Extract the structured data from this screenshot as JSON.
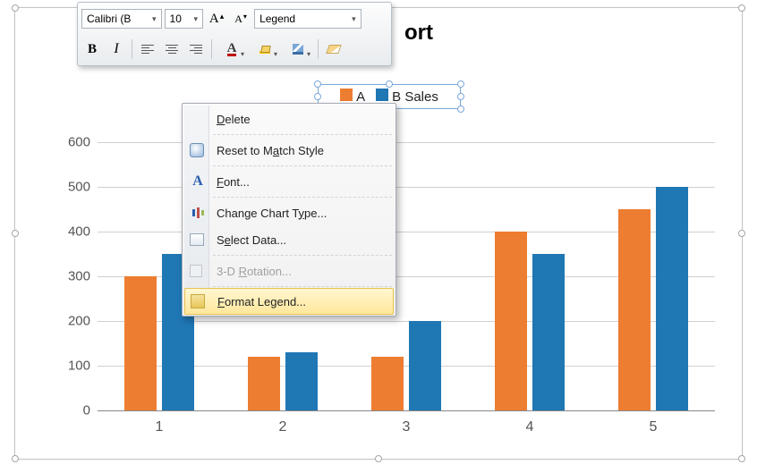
{
  "chart_data": {
    "type": "bar",
    "title": "ort",
    "categories": [
      "1",
      "2",
      "3",
      "4",
      "5"
    ],
    "series": [
      {
        "name": "A",
        "color": "#ED7D31",
        "values": [
          300,
          120,
          120,
          400,
          450
        ]
      },
      {
        "name": "B Sales",
        "color": "#1F77B4",
        "values": [
          350,
          130,
          200,
          350,
          500
        ]
      }
    ],
    "ylim": [
      0,
      600
    ],
    "y_ticks": [
      0,
      100,
      200,
      300,
      400,
      500,
      600
    ],
    "xlabel": "",
    "ylabel": "",
    "legend_position": "top"
  },
  "mini_toolbar": {
    "font_name": "Calibri (B",
    "font_size": "10",
    "style_box": "Legend",
    "bold": "B",
    "italic": "I",
    "grow_font": "A",
    "grow_font_arrow": "▴",
    "shrink_font": "A",
    "shrink_font_arrow": "▾"
  },
  "legend": {
    "a_label": "A",
    "b_label": "B Sales"
  },
  "context_menu": {
    "delete": "Delete",
    "reset": "Reset to Match Style",
    "font": "Font...",
    "chart_type": "Change Chart Type...",
    "select_data": "Select Data...",
    "rotation": "3-D Rotation...",
    "format_legend": "Format Legend..."
  },
  "title_visible": "ort"
}
